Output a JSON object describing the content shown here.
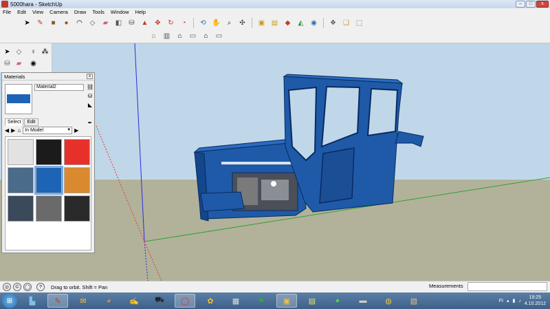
{
  "window": {
    "title": "5000hara - SketchUp",
    "minimize": "–",
    "maximize": "□",
    "close": "x"
  },
  "menu": [
    "File",
    "Edit",
    "View",
    "Camera",
    "Draw",
    "Tools",
    "Window",
    "Help"
  ],
  "materials_panel": {
    "title": "Materials",
    "close": "x",
    "material_name": "Material2",
    "tabs": [
      "Select",
      "Edit"
    ],
    "collection": "In Model",
    "swatch_colors": [
      "#e2e2e2",
      "#1b1b1b",
      "#e8302a",
      "#4a6b8a",
      "#1e64b6",
      "#d98a2e",
      "#3a4a5a",
      "#6a6a6a",
      "#2a2a2a"
    ]
  },
  "statusbar": {
    "hint": "Drag to orbit.  Shift = Pan",
    "measurements_label": "Measurements"
  },
  "taskbar": {
    "time": "19:25",
    "date": "4.10.2012",
    "lang": "FI"
  },
  "colors": {
    "sky": "#bfd7e8",
    "ground": "#b2b29b",
    "model_blue": "#1e5aa8",
    "axis_red": "#e23a2a",
    "axis_green": "#2fa02f",
    "axis_blue": "#2a2ae0"
  }
}
